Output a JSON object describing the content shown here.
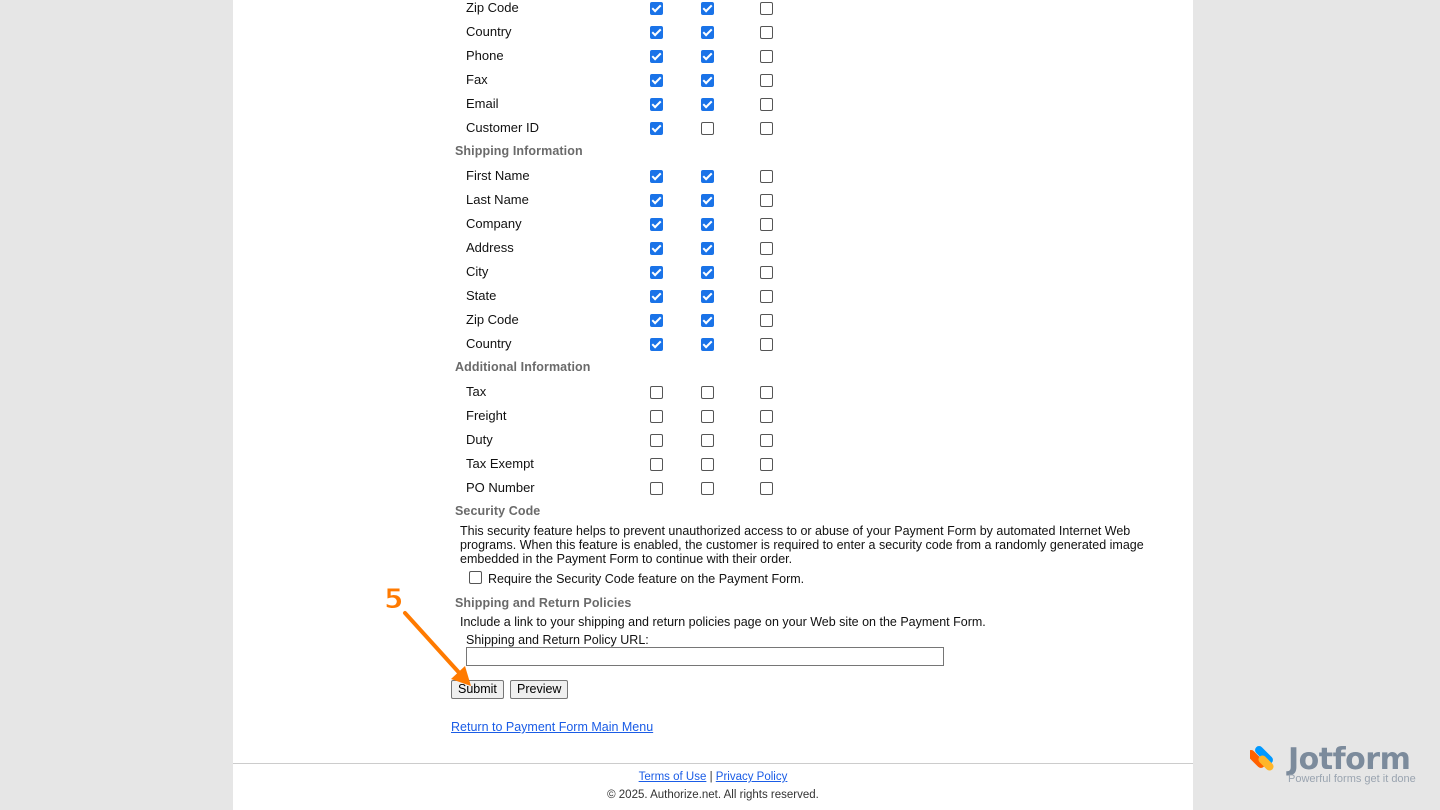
{
  "sections": [
    {
      "key": "billing-tail",
      "title": "",
      "start_top": 0,
      "rows": [
        {
          "label": "Zip Code",
          "checks": [
            true,
            true,
            false
          ]
        },
        {
          "label": "Country",
          "checks": [
            true,
            true,
            false
          ]
        },
        {
          "label": "Phone",
          "checks": [
            true,
            true,
            false
          ]
        },
        {
          "label": "Fax",
          "checks": [
            true,
            true,
            false
          ]
        },
        {
          "label": "Email",
          "checks": [
            true,
            true,
            false
          ]
        },
        {
          "label": "Customer ID",
          "checks": [
            true,
            false,
            false
          ]
        }
      ]
    },
    {
      "key": "shipping",
      "title": "Shipping Information",
      "rows": [
        {
          "label": "First Name",
          "checks": [
            true,
            true,
            false
          ]
        },
        {
          "label": "Last Name",
          "checks": [
            true,
            true,
            false
          ]
        },
        {
          "label": "Company",
          "checks": [
            true,
            true,
            false
          ]
        },
        {
          "label": "Address",
          "checks": [
            true,
            true,
            false
          ]
        },
        {
          "label": "City",
          "checks": [
            true,
            true,
            false
          ]
        },
        {
          "label": "State",
          "checks": [
            true,
            true,
            false
          ]
        },
        {
          "label": "Zip Code",
          "checks": [
            true,
            true,
            false
          ]
        },
        {
          "label": "Country",
          "checks": [
            true,
            true,
            false
          ]
        }
      ]
    },
    {
      "key": "additional",
      "title": "Additional Information",
      "rows": [
        {
          "label": "Tax",
          "checks": [
            false,
            false,
            false
          ]
        },
        {
          "label": "Freight",
          "checks": [
            false,
            false,
            false
          ]
        },
        {
          "label": "Duty",
          "checks": [
            false,
            false,
            false
          ]
        },
        {
          "label": "Tax Exempt",
          "checks": [
            false,
            false,
            false
          ]
        },
        {
          "label": "PO Number",
          "checks": [
            false,
            false,
            false
          ]
        }
      ]
    }
  ],
  "security": {
    "title": "Security Code",
    "description": "This security feature helps to prevent unauthorized access to or abuse of your Payment Form by automated Internet Web programs. When this feature is enabled, the customer is required to enter a security code from a randomly generated image embedded in the Payment Form to continue with their order.",
    "checkbox_label": "Require the Security Code feature on the Payment Form.",
    "checked": false
  },
  "policies": {
    "title": "Shipping and Return Policies",
    "description": "Include a link to your shipping and return policies page on your Web site on the Payment Form.",
    "url_label": "Shipping and Return Policy URL:",
    "url_value": ""
  },
  "buttons": {
    "submit": "Submit",
    "preview": "Preview"
  },
  "return_link": "Return to Payment Form Main Menu",
  "footer": {
    "terms": "Terms of Use",
    "separator": "|",
    "privacy": "Privacy Policy",
    "copyright": "© 2025. Authorize.net. All rights reserved."
  },
  "annotation": {
    "step": "5"
  },
  "branding": {
    "name": "Jotform",
    "tagline": "Powerful forms get it done"
  },
  "colors": {
    "checkbox": "#1a73e8",
    "link": "#1a5ce6",
    "annotation": "#ff7a00"
  }
}
